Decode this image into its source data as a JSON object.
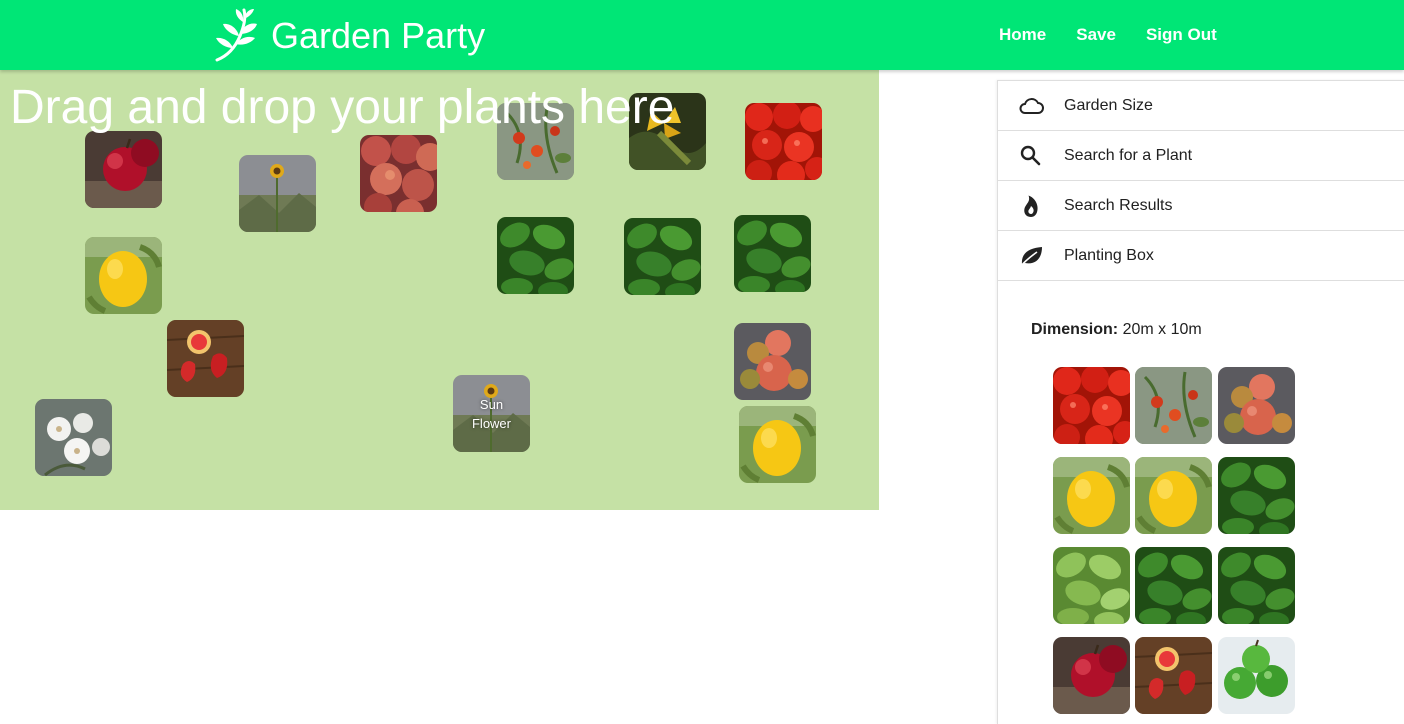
{
  "brand": {
    "title": "Garden Party",
    "logo_icon": "leaf-sprig-icon"
  },
  "nav": {
    "links": [
      "Home",
      "Save",
      "Sign Out"
    ]
  },
  "garden": {
    "title": "Drag and drop your plants here",
    "background": "#c5e1a5",
    "plants": [
      {
        "type": "red-apple"
      },
      {
        "type": "sunflower"
      },
      {
        "type": "peach"
      },
      {
        "type": "tomato-plant"
      },
      {
        "type": "zucchini-flower"
      },
      {
        "type": "tomato"
      },
      {
        "type": "lemon"
      },
      {
        "type": "basil"
      },
      {
        "type": "basil"
      },
      {
        "type": "basil"
      },
      {
        "type": "strawberry-apple"
      },
      {
        "type": "heirloom-tomato"
      },
      {
        "type": "orchid"
      },
      {
        "type": "sunflower",
        "caption": "Sun Flower"
      },
      {
        "type": "lemon"
      }
    ]
  },
  "sidebar": {
    "items": [
      {
        "label": "Garden Size",
        "icon": "cloud-icon"
      },
      {
        "label": "Search for a Plant",
        "icon": "search-icon"
      },
      {
        "label": "Search Results",
        "icon": "fire-icon"
      },
      {
        "label": "Planting Box",
        "icon": "leaf-icon"
      }
    ],
    "dimension_label": "Dimension:",
    "dimension_value": "20m x 10m"
  },
  "planting_box": {
    "plants": [
      {
        "type": "tomato"
      },
      {
        "type": "tomato-plant"
      },
      {
        "type": "heirloom-tomato"
      },
      {
        "type": "lemon"
      },
      {
        "type": "lemon"
      },
      {
        "type": "basil"
      },
      {
        "type": "light-basil"
      },
      {
        "type": "basil"
      },
      {
        "type": "basil"
      },
      {
        "type": "red-apple"
      },
      {
        "type": "strawberry-apple"
      },
      {
        "type": "green-apple"
      }
    ]
  },
  "colors": {
    "accent": "#00e676",
    "garden": "#c5e1a5"
  }
}
